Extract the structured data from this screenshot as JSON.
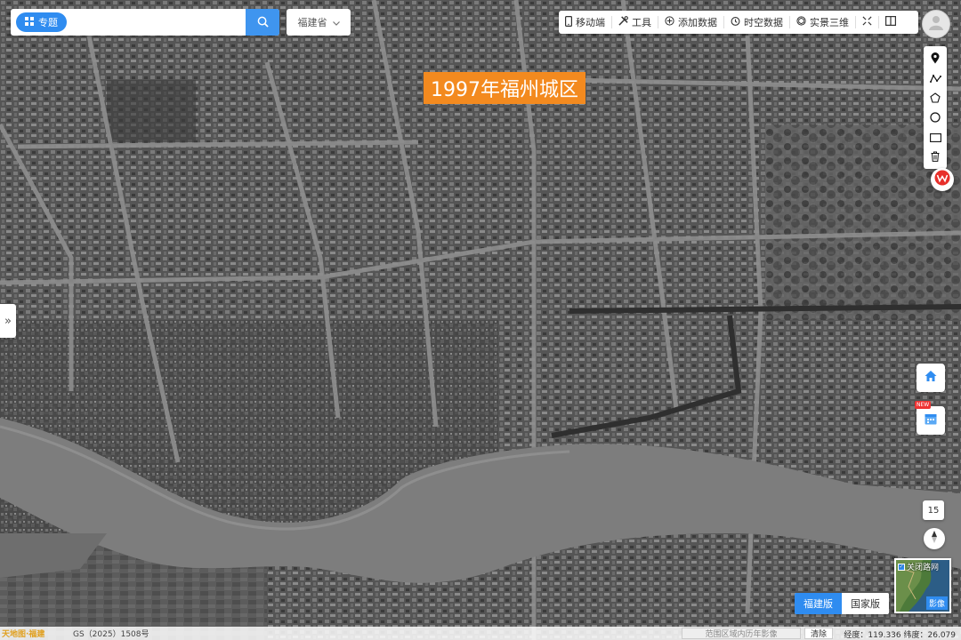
{
  "search": {
    "topic_label": "专题",
    "query": "",
    "placeholder": "",
    "region": "福建省"
  },
  "toolbar": {
    "mobile": "移动端",
    "tools": "工具",
    "add_data": "添加数据",
    "spatiotemporal": "时空数据",
    "streetview_3d": "实景三维"
  },
  "map": {
    "title": "1997年福州城区",
    "zoom": "15",
    "style": "grayscale-satellite"
  },
  "version_switch": {
    "fujian": "福建版",
    "national": "国家版",
    "active": "福建版"
  },
  "minimap": {
    "roadnet_label": "关闭路网",
    "imagery_label": "影像"
  },
  "calendar": {
    "badge": "NEW"
  },
  "status": {
    "logo": "天地图·福建",
    "gs": "GS（2025）1508号",
    "history_placeholder": "范围区域内历年影像",
    "clear": "清除",
    "coords": "经度：119.336 纬度：26.079"
  },
  "colors": {
    "accent_blue": "#2f8cf0",
    "title_orange": "#f38a1f"
  }
}
